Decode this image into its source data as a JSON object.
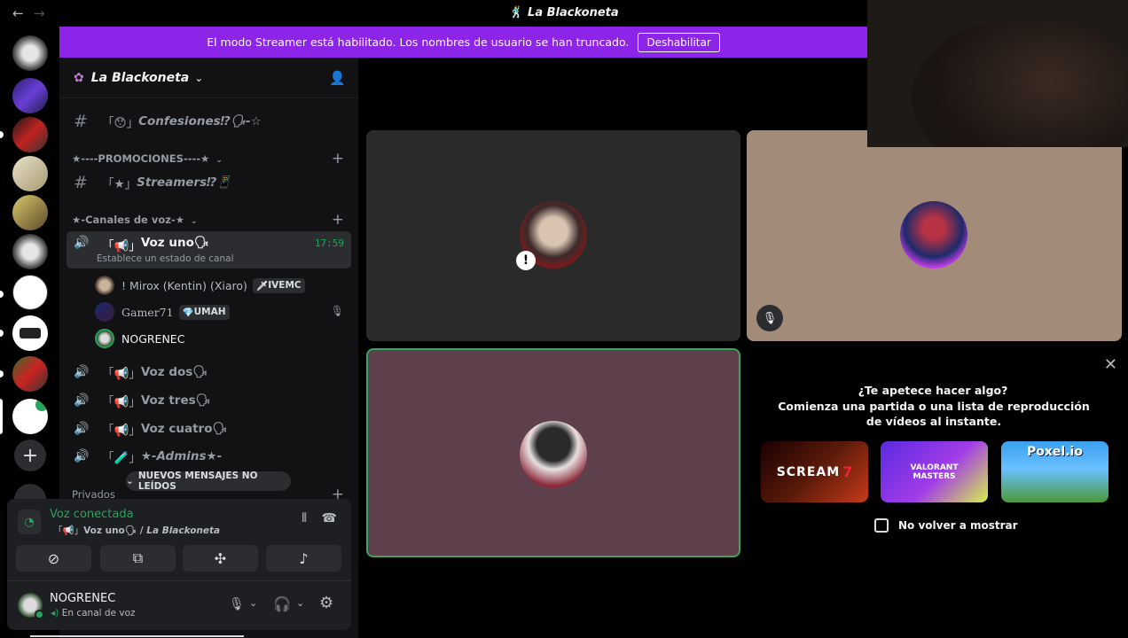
{
  "window": {
    "title": "La Blackoneta",
    "back_icon": "←",
    "forward_icon": "→"
  },
  "banner": {
    "message": "El modo Streamer está habilitado. Los nombres de usuario se han truncado.",
    "button": "Deshabilitar",
    "color": "#8c25e8"
  },
  "server": {
    "name": "La Blackoneta",
    "chevron": "⌄"
  },
  "channels": {
    "confesiones": {
      "prefix": "「😯」",
      "name": "Confesiones⁉🗣-☆"
    },
    "promo_category": "★----PROMOCIONES----★",
    "streamers": {
      "prefix": "「★」",
      "name": "Streamers⁉📱"
    },
    "voice_category": "★-Canales de voz-★",
    "voz_uno": {
      "prefix": "「📢」",
      "name": "Voz uno🗣",
      "time": "17:59",
      "status": "Establece un estado de canal"
    },
    "users": [
      {
        "name": "! Mirox (Kentin) (Xiaro)",
        "tag": "IVEMC",
        "tag_icon": "🗡"
      },
      {
        "name": "Gamer71",
        "tag": "UMAH",
        "tag_icon": "💎"
      },
      {
        "name": "NOGRENEC"
      }
    ],
    "voz_dos": {
      "prefix": "「📢」",
      "name": "Voz dos🗣"
    },
    "voz_tres": {
      "prefix": "「📢」",
      "name": "Voz tres🗣"
    },
    "voz_cuatro": {
      "prefix": "「📢」",
      "name": "Voz cuatro🗣"
    },
    "admins": {
      "prefix": "「🧪」",
      "name": "★-Admins★-"
    },
    "privados_category": "Privados",
    "new_messages": "NUEVOS MENSAJES NO LEÍDOS"
  },
  "voice": {
    "status": "Voz conectada",
    "channel_prefix": "「📢」",
    "channel_name": "Voz uno🗣 / ",
    "server_name": "La Blackoneta",
    "accent": "#23a55a"
  },
  "user": {
    "name": "NOGRENEC",
    "status": "En canal de voz"
  },
  "activity": {
    "title": "¿Te apetece hacer algo?",
    "subtitle": "Comienza una partida o una lista de reproducción de vídeos al instante.",
    "games": [
      {
        "label": "SCREAM",
        "sublabel": "7"
      },
      {
        "label": "VALORANT",
        "sublabel": "MASTERS"
      },
      {
        "label": "Poxel.io",
        "sublabel": ""
      }
    ],
    "checkbox_label": "No volver a mostrar"
  }
}
